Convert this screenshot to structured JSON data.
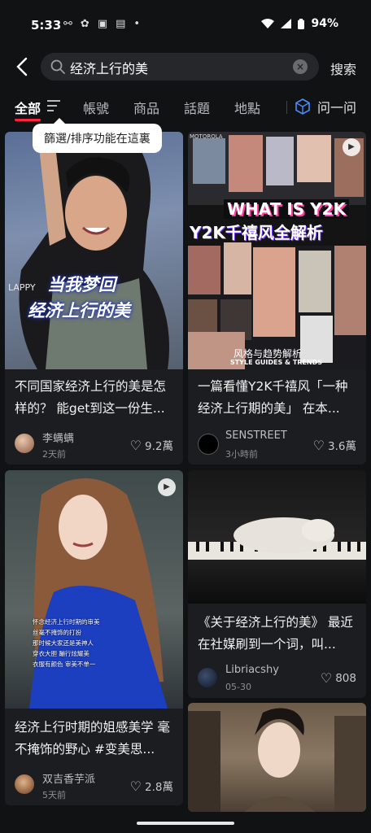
{
  "status": {
    "time": "5:33",
    "battery": "94%"
  },
  "search": {
    "query": "经济上行的美",
    "search_button": "搜索"
  },
  "tabs": {
    "all": "全部",
    "accounts": "帳號",
    "products": "商品",
    "topics": "話題",
    "places": "地點",
    "ask": "问一问"
  },
  "tooltip": "篩選/排序功能在這裏",
  "cards": [
    {
      "title": "不同国家经济上行的美是怎样的？ 能get到这一份生...",
      "author": "李螨螨",
      "ago": "2天前",
      "likes": "9.2萬",
      "overlay_line1": "当我梦回",
      "overlay_line2": "经济上行的美",
      "overlay_small": "LAPPY"
    },
    {
      "title": "一篇看懂Y2K千禧风「一种经济上行期的美」 在本...",
      "author": "SENSTREET",
      "ago": "3小時前",
      "likes": "3.6萬",
      "overlay_what": "WHAT IS Y2K",
      "overlay_title": "Y2K千禧风全解析",
      "overlay_sub1": "风格与趋势解析",
      "overlay_sub2": "STYLE GUIDES & TRENDS",
      "brand": "MOTOROLA"
    },
    {
      "title": "经济上行时期的姐感美学 毫不掩饰的野心 #变美思...",
      "author": "双吉香芋派",
      "ago": "5天前",
      "likes": "2.8萬",
      "overlay_lines": [
        "怀念经济上行时期的审美",
        "丝毫不掩饰的打扮",
        "那时候大家还是美神人",
        "穿衣大胆 蹦行炫耀美",
        "衣服有颜色 审美不单一"
      ]
    },
    {
      "title": "《关于经济上行的美》 最近在社媒刷到一个词，叫...",
      "author": "Libriacshy",
      "ago": "05-30",
      "likes": "808"
    }
  ],
  "colors": {
    "accent": "#ff2442",
    "background": "#111214",
    "card": "#1c1d20"
  }
}
